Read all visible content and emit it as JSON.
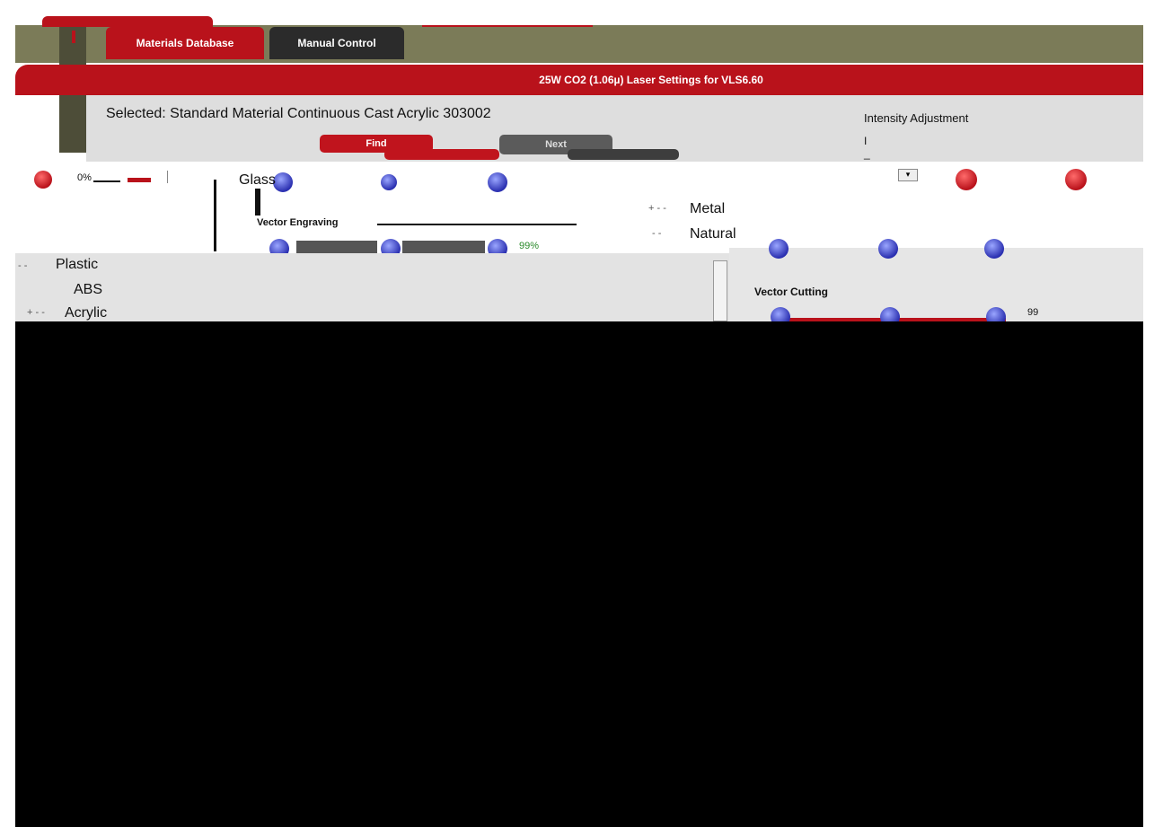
{
  "tabs": [
    {
      "label": "Materials Database",
      "active": true
    },
    {
      "label": "Manual Control",
      "active": false
    }
  ],
  "header": {
    "title": "25W CO2 (1.06µ) Laser Settings for VLS6.60"
  },
  "selection": {
    "selected_text": "Selected: Standard Material Continuous Cast Acrylic 303002",
    "intensity_label": "Intensity Adjustment",
    "intensity_value": "I _"
  },
  "buttons": {
    "red_label": "Find",
    "grey_label": "Next"
  },
  "strip": {
    "left_percent": "0%"
  },
  "tree": {
    "items": [
      "Glass",
      "Metal",
      "Natural",
      "Plastic",
      "ABS",
      "Acrylic"
    ],
    "toggle_collapsed": "+ - -",
    "toggle_plain": "- -"
  },
  "sections": {
    "vector_engraving": "Vector Engraving",
    "vector_cutting": "Vector Cutting",
    "engraving_value": "99%",
    "cutting_value": "99"
  },
  "colors": {
    "brand_red": "#b9121b",
    "frame_olive": "#7b7b58",
    "knob_blue": "#2a2fb0"
  }
}
